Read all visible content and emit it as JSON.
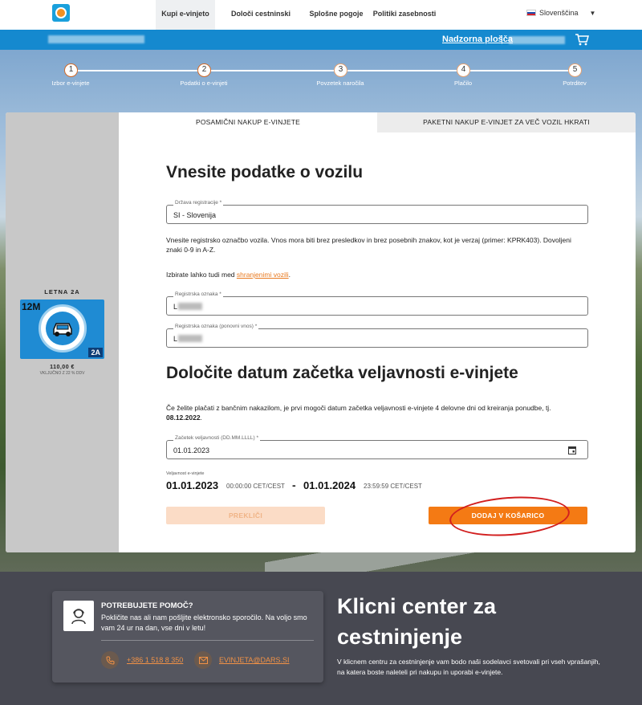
{
  "nav": {
    "items": [
      {
        "label": "Kupi e-vinjeto",
        "active": true
      },
      {
        "label": "Določi cestninski razred",
        "active": false
      },
      {
        "label": "Splošne pogoje",
        "active": false
      },
      {
        "label": "Politiki zasebnosti",
        "active": false
      }
    ],
    "language": "Slovenščina"
  },
  "bluebar": {
    "dashboard_link": "Nadzorna plošča",
    "separator": "|"
  },
  "steps": [
    {
      "number": "1",
      "label": "Izbor e-vinjete"
    },
    {
      "number": "2",
      "label": "Podatki o e-vinjeti"
    },
    {
      "number": "3",
      "label": "Povzetek naročila"
    },
    {
      "number": "4",
      "label": "Plačilo"
    },
    {
      "number": "5",
      "label": "Potrditev"
    }
  ],
  "tabs": {
    "single": "POSAMIČNI NAKUP E-VINJETE",
    "bulk": "PAKETNI NAKUP E-VINJET ZA VEČ VOZIL HKRATI"
  },
  "vignette": {
    "title": "LETNA 2A",
    "badge_left": "12M",
    "badge_right": "2A",
    "price": "110,00 €",
    "vat": "VKLJUČNO Z 22 % DDV"
  },
  "vehicle_section": {
    "heading": "Vnesite podatke o vozilu",
    "country_label": "Država registracije *",
    "country_value": "SI - Slovenija",
    "instruction": "Vnesite registrsko označbo vozila. Vnos mora biti brez presledkov in brez posebnih znakov, kot je verzaj (primer: KPRK403). Dovoljeni znaki 0-9 in A-Z.",
    "saved_prefix": "Izbirate lahko tudi med ",
    "saved_link": "shranjenimi vozili",
    "saved_suffix": ".",
    "plate_label": "Registrska oznaka *",
    "plate_value_prefix": "L",
    "plate_repeat_label": "Registrska oznaka (ponovni vnos) *",
    "plate_repeat_prefix": "L"
  },
  "date_section": {
    "heading": "Določite datum začetka veljavnosti e-vinjete",
    "info_prefix": "Če želite plačati z bančnim nakazilom, je prvi mogoči datum začetka veljavnosti e-vinjete 4 delovne dni od kreiranja ponudbe, tj. ",
    "info_date": "08.12.2022",
    "info_suffix": ".",
    "start_label": "Začetek veljavnosti (DD.MM.LLLL) *",
    "start_value": "01.01.2023",
    "validity_label": "Veljavnost e-vinjete",
    "from_date": "01.01.2023",
    "from_time": "00:00:00 CET/CEST",
    "dash": "-",
    "to_date": "01.01.2024",
    "to_time": "23:59:59 CET/CEST"
  },
  "buttons": {
    "cancel": "PREKLIČI",
    "add": "DODAJ V KOŠARICO"
  },
  "footer": {
    "help_title": "POTREBUJETE POMOČ?",
    "help_text": "Pokličite nas ali nam pošljite elektronsko sporočilo. Na voljo smo vam 24 ur na dan, vse dni v letu!",
    "phone": "+386 1 518 8 350",
    "email": "EVINJETA@DARS.SI",
    "center_title": "Klicni center za cestninjenje",
    "center_text": "V klicnem centru za cestninjenje vam bodo naši sodelavci svetovali pri vseh vprašanjih, na katera boste naleteli pri nakupu in uporabi e-vinjete."
  },
  "colors": {
    "brand_blue": "#1589cf",
    "accent_orange": "#f47a14",
    "annotation_red": "#d21f1f"
  }
}
